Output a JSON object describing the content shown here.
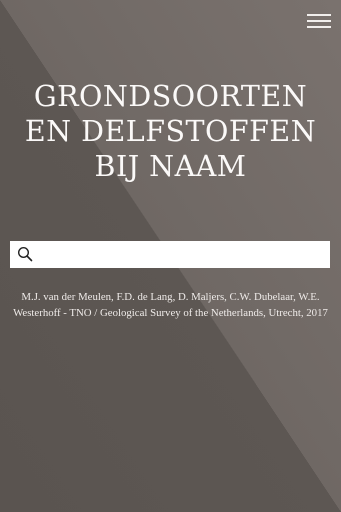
{
  "header": {
    "menu_icon": "hamburger-icon"
  },
  "hero": {
    "title_lines": [
      "GRONDSOORTEN",
      "EN DELFSTOFFEN",
      "BIJ NAAM"
    ]
  },
  "search": {
    "icon": "search-icon",
    "value": "",
    "placeholder": ""
  },
  "credits": {
    "text": "M.J. van der Meulen, F.D. de Lang, D. Maljers, C.W. Dubelaar, W.E. Westerhoff  -  TNO / Geological Survey of the Netherlands, Utrecht, 2017"
  },
  "colors": {
    "background_dark": "#5d5753",
    "background_light": "#7a726e",
    "text": "#fbf9f8"
  }
}
